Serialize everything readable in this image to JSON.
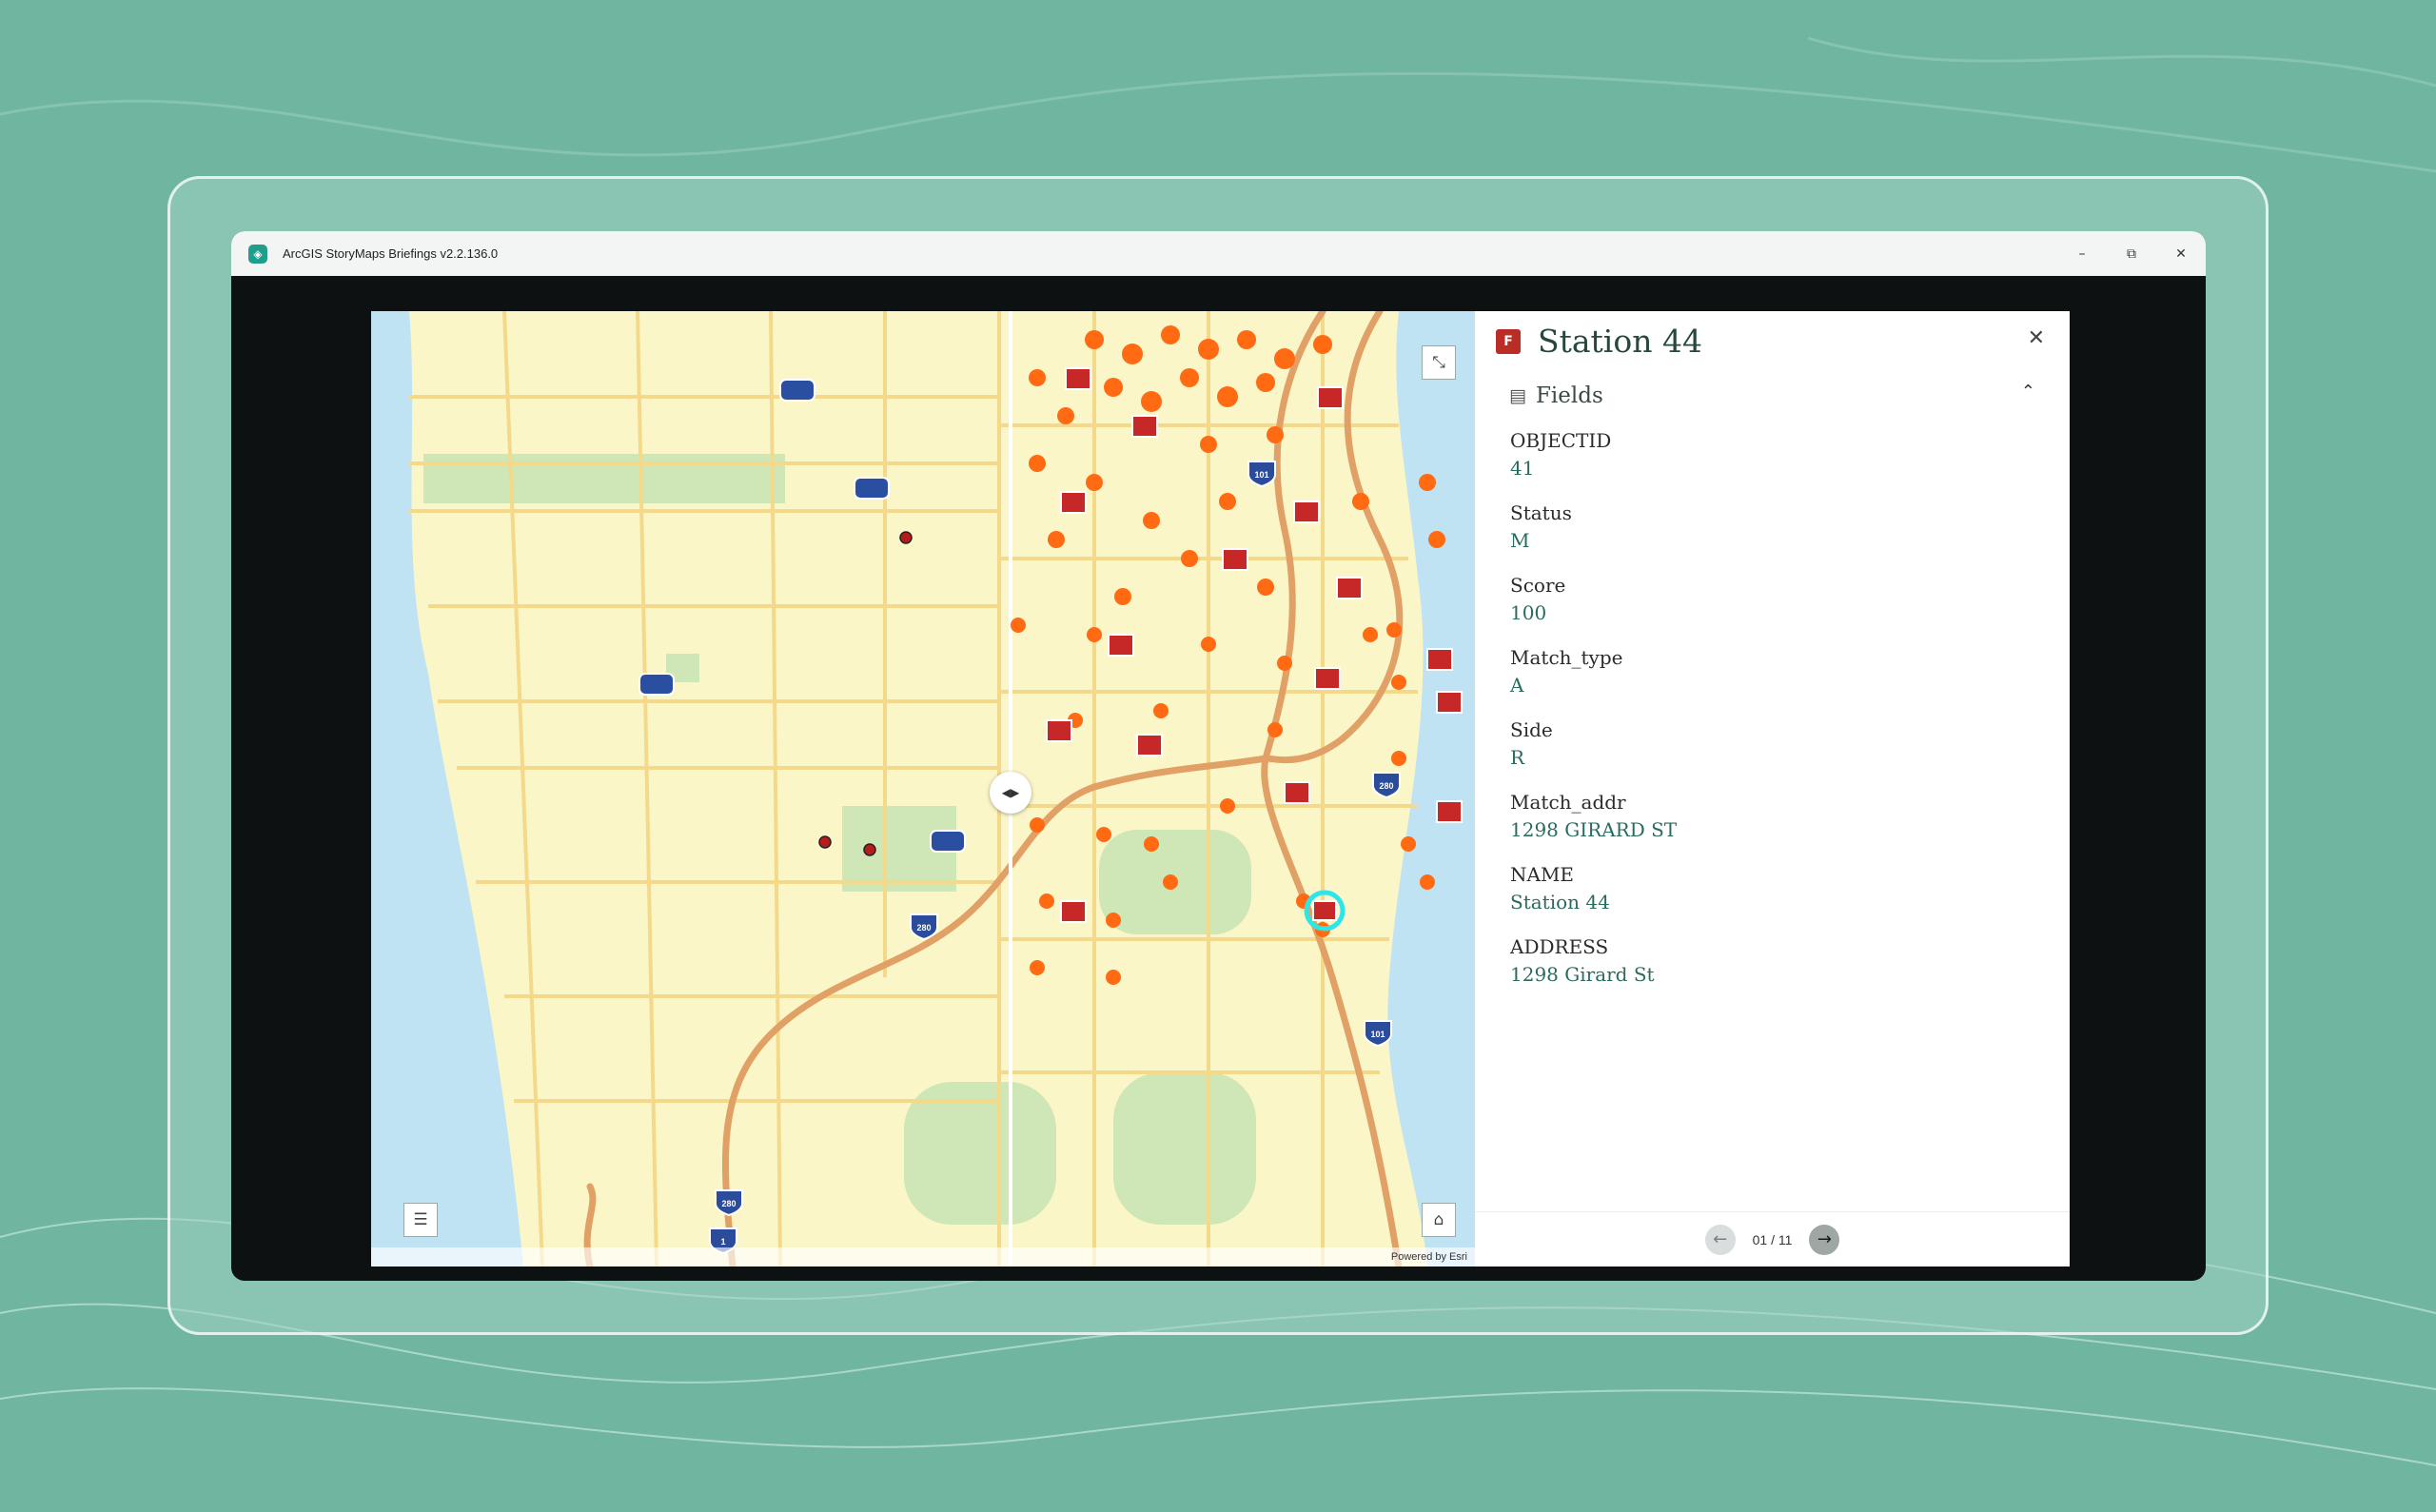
{
  "window": {
    "title": "ArcGIS StoryMaps Briefings v2.2.136.0",
    "controls": {
      "minimize": "–",
      "restore": "⧉",
      "close": "✕"
    }
  },
  "map": {
    "attribution": "Powered by Esri",
    "swipe_handle": "◀▶",
    "legend_icon": "☰",
    "home_icon": "⌂",
    "expand_icon": "⤡",
    "shields": [
      "280",
      "101",
      "280",
      "280",
      "1",
      "101"
    ]
  },
  "feature": {
    "title": "Station 44",
    "close_label": "✕",
    "section_title": "Fields",
    "fields": [
      {
        "label": "OBJECTID",
        "value": "41"
      },
      {
        "label": "Status",
        "value": "M"
      },
      {
        "label": "Score",
        "value": "100"
      },
      {
        "label": "Match_type",
        "value": "A"
      },
      {
        "label": "Side",
        "value": "R"
      },
      {
        "label": "Match_addr",
        "value": "1298 GIRARD ST"
      },
      {
        "label": "NAME",
        "value": "Station 44"
      },
      {
        "label": "ADDRESS",
        "value": "1298 Girard St"
      }
    ]
  },
  "pager": {
    "text": "01 / 11",
    "prev": "←",
    "next": "→"
  },
  "colors": {
    "accent": "#27483f",
    "value_text": "#2a6b5f",
    "map_land": "#fbf6c8",
    "map_water": "#bfe3f2",
    "map_park": "#cfe6b6",
    "highway": "#e0a066",
    "background": "#6fb5a0"
  }
}
